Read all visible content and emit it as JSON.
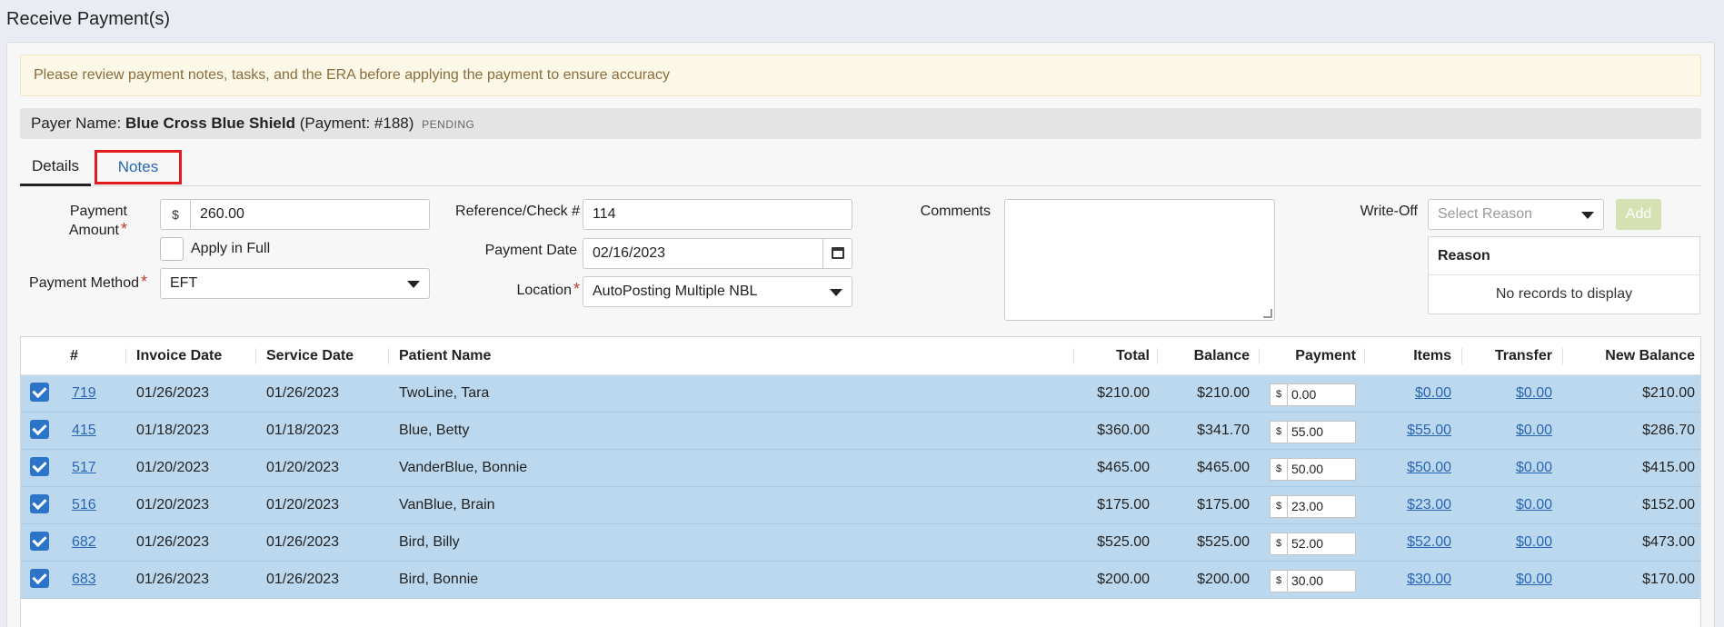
{
  "page_title": "Receive Payment(s)",
  "alert": "Please review payment notes, tasks, and the ERA before applying the payment to ensure accuracy",
  "payer": {
    "label": "Payer Name: ",
    "name": "Blue Cross Blue Shield",
    "payment_ref": "(Payment: #188)",
    "status": "PENDING"
  },
  "tabs": [
    {
      "label": "Details",
      "active": true
    },
    {
      "label": "Notes",
      "active": false
    }
  ],
  "form": {
    "payment_amount_label": "Payment Amount",
    "currency_symbol": "$",
    "payment_amount": "260.00",
    "apply_in_full_label": "Apply in Full",
    "payment_method_label": "Payment Method",
    "payment_method": "EFT",
    "reference_label": "Reference/Check #",
    "reference": "114",
    "payment_date_label": "Payment Date",
    "payment_date": "02/16/2023",
    "location_label": "Location",
    "location": "AutoPosting Multiple NBL",
    "comments_label": "Comments",
    "required_mark": "*"
  },
  "writeoff": {
    "label": "Write-Off",
    "placeholder": "Select Reason",
    "add_label": "Add",
    "table_header": "Reason",
    "empty_text": "No records to display"
  },
  "grid": {
    "columns": [
      "#",
      "Invoice Date",
      "Service Date",
      "Patient Name",
      "Total",
      "Balance",
      "Payment",
      "Items",
      "Transfer",
      "New Balance"
    ],
    "rows": [
      {
        "num": "719",
        "invoice_date": "01/26/2023",
        "service_date": "01/26/2023",
        "patient": "TwoLine, Tara",
        "total": "$210.00",
        "balance": "$210.00",
        "payment": "0.00",
        "items": "$0.00",
        "transfer": "$0.00",
        "new_balance": "$210.00"
      },
      {
        "num": "415",
        "invoice_date": "01/18/2023",
        "service_date": "01/18/2023",
        "patient": "Blue, Betty",
        "total": "$360.00",
        "balance": "$341.70",
        "payment": "55.00",
        "items": "$55.00",
        "transfer": "$0.00",
        "new_balance": "$286.70"
      },
      {
        "num": "517",
        "invoice_date": "01/20/2023",
        "service_date": "01/20/2023",
        "patient": "VanderBlue, Bonnie",
        "total": "$465.00",
        "balance": "$465.00",
        "payment": "50.00",
        "items": "$50.00",
        "transfer": "$0.00",
        "new_balance": "$415.00"
      },
      {
        "num": "516",
        "invoice_date": "01/20/2023",
        "service_date": "01/20/2023",
        "patient": "VanBlue, Brain",
        "total": "$175.00",
        "balance": "$175.00",
        "payment": "23.00",
        "items": "$23.00",
        "transfer": "$0.00",
        "new_balance": "$152.00"
      },
      {
        "num": "682",
        "invoice_date": "01/26/2023",
        "service_date": "01/26/2023",
        "patient": "Bird, Billy",
        "total": "$525.00",
        "balance": "$525.00",
        "payment": "52.00",
        "items": "$52.00",
        "transfer": "$0.00",
        "new_balance": "$473.00"
      },
      {
        "num": "683",
        "invoice_date": "01/26/2023",
        "service_date": "01/26/2023",
        "patient": "Bird, Bonnie",
        "total": "$200.00",
        "balance": "$200.00",
        "payment": "30.00",
        "items": "$30.00",
        "transfer": "$0.00",
        "new_balance": "$170.00"
      }
    ]
  },
  "colors": {
    "row_selected": "#bcd8ee",
    "link": "#2a66b3",
    "required": "#c0392b",
    "highlight_box": "#e01b1b"
  }
}
